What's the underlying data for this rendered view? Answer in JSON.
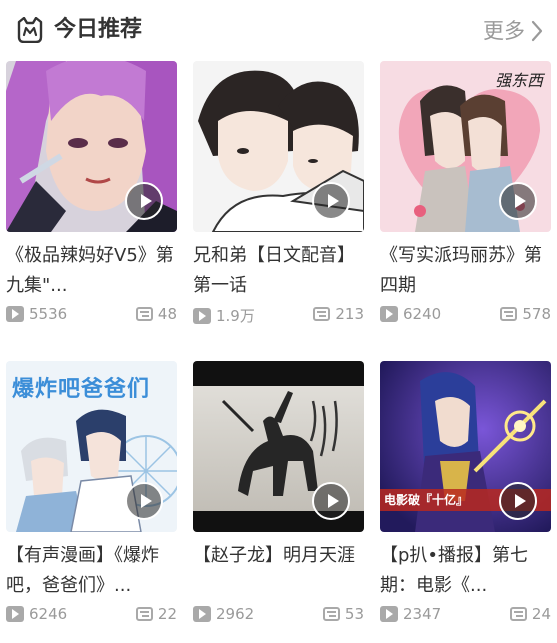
{
  "header": {
    "title": "今日推荐",
    "more_label": "更多"
  },
  "cards": [
    {
      "title": "《极品辣妈好V5》第九集\"...",
      "plays": "5536",
      "comments": "48"
    },
    {
      "title": "兄和弟【日文配音】第一话",
      "plays": "1.9万",
      "comments": "213"
    },
    {
      "title": "《写实派玛丽苏》第四期",
      "plays": "6240",
      "comments": "578"
    },
    {
      "title": "【有声漫画】《爆炸吧，爸爸们》...",
      "plays": "6246",
      "comments": "22"
    },
    {
      "title": "【赵子龙】明月天涯",
      "plays": "2962",
      "comments": "53"
    },
    {
      "title": "【p扒•播报】第七期：电影《...",
      "plays": "2347",
      "comments": "24"
    }
  ],
  "thumb_text": {
    "card3": "强东西",
    "card4": "爆炸吧爸爸们",
    "card6_badge": "电影破『十亿』"
  }
}
